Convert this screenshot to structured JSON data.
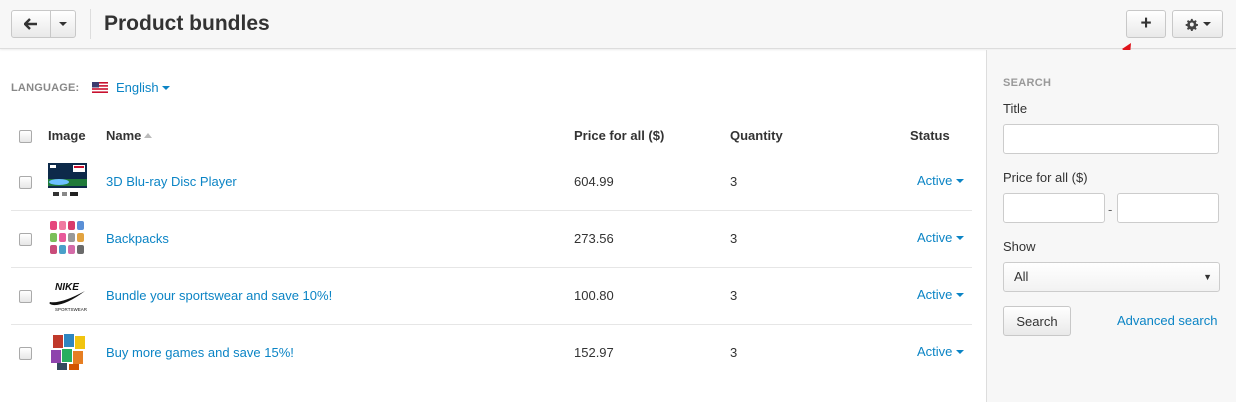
{
  "header": {
    "title": "Product bundles",
    "back_icon": "arrow-left-icon",
    "add_label": "+",
    "settings_icon": "gear-icon"
  },
  "language": {
    "label": "LANGUAGE:",
    "value": "English",
    "flag_icon": "us-flag-icon"
  },
  "table": {
    "columns": {
      "image": "Image",
      "name": "Name",
      "price": "Price for all ($)",
      "quantity": "Quantity",
      "status": "Status"
    },
    "rows": [
      {
        "name": "3D Blu-ray Disc Player",
        "price": "604.99",
        "quantity": "3",
        "status": "Active",
        "thumb_icon": "blu-ray-player-thumbnail"
      },
      {
        "name": "Backpacks",
        "price": "273.56",
        "quantity": "3",
        "status": "Active",
        "thumb_icon": "backpacks-thumbnail"
      },
      {
        "name": "Bundle your sportswear and save 10%!",
        "price": "100.80",
        "quantity": "3",
        "status": "Active",
        "thumb_icon": "nike-sportswear-logo"
      },
      {
        "name": "Buy more games and save 15%!",
        "price": "152.97",
        "quantity": "3",
        "status": "Active",
        "thumb_icon": "games-thumbnail"
      }
    ]
  },
  "sidebar": {
    "heading": "SEARCH",
    "title_label": "Title",
    "title_value": "",
    "price_label": "Price for all ($)",
    "price_from": "",
    "price_separator": "-",
    "price_to": "",
    "show_label": "Show",
    "show_value": "All",
    "search_button": "Search",
    "advanced_link": "Advanced search"
  },
  "colors": {
    "link": "#0b84c5",
    "annotation_arrow": "#e0141b",
    "sidebar_bg": "#f7f7f7"
  }
}
